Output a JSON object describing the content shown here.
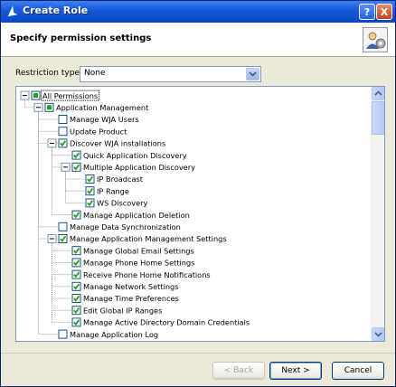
{
  "window": {
    "title": "Create Role",
    "help_label": "?",
    "close_label": "X"
  },
  "header": {
    "title": "Specify permission settings"
  },
  "restriction": {
    "label": "Restriction type",
    "value": "None"
  },
  "tree": {
    "items": [
      {
        "label": "All Permissions",
        "level": 0,
        "check": "partial",
        "expander": "minus",
        "selected": true
      },
      {
        "label": "Application Management",
        "level": 1,
        "check": "partial",
        "expander": "minus"
      },
      {
        "label": "Manage WJA Users",
        "level": 2,
        "check": "unchecked",
        "expander": "none"
      },
      {
        "label": "Update Product",
        "level": 2,
        "check": "unchecked",
        "expander": "none"
      },
      {
        "label": "Discover WJA installations",
        "level": 2,
        "check": "checked",
        "expander": "minus"
      },
      {
        "label": "Quick Application Discovery",
        "level": 3,
        "check": "checked",
        "expander": "none"
      },
      {
        "label": "Multiple Application Discovery",
        "level": 3,
        "check": "checked",
        "expander": "minus"
      },
      {
        "label": "IP Broadcast",
        "level": 4,
        "check": "checked",
        "expander": "none"
      },
      {
        "label": "IP Range",
        "level": 4,
        "check": "checked",
        "expander": "none"
      },
      {
        "label": "WS Discovery",
        "level": 4,
        "check": "checked",
        "expander": "none"
      },
      {
        "label": "Manage Application Deletion",
        "level": 3,
        "check": "checked",
        "expander": "none"
      },
      {
        "label": "Manage Data Synchronization",
        "level": 2,
        "check": "unchecked",
        "expander": "none"
      },
      {
        "label": "Manage Application Management Settings",
        "level": 2,
        "check": "checked",
        "expander": "minus"
      },
      {
        "label": "Manage Global Email Settings",
        "level": 3,
        "check": "checked",
        "expander": "none"
      },
      {
        "label": "Manage Phone Home Settings",
        "level": 3,
        "check": "checked",
        "expander": "none"
      },
      {
        "label": "Receive Phone Home Notifications",
        "level": 3,
        "check": "checked",
        "expander": "none"
      },
      {
        "label": "Manage Network Settings",
        "level": 3,
        "check": "checked",
        "expander": "none"
      },
      {
        "label": "Manage Time Preferences",
        "level": 3,
        "check": "checked",
        "expander": "none"
      },
      {
        "label": "Edit Global IP Ranges",
        "level": 3,
        "check": "checked",
        "expander": "none"
      },
      {
        "label": "Manage Active Directory Domain Credentials",
        "level": 3,
        "check": "checked",
        "expander": "none"
      },
      {
        "label": "Manage Application Log",
        "level": 2,
        "check": "unchecked",
        "expander": "none"
      }
    ]
  },
  "buttons": {
    "back": "< Back",
    "next": "Next >",
    "cancel": "Cancel"
  },
  "colors": {
    "titlebar": "#0a47c4",
    "check": "#21a121",
    "selection": "#316ac5"
  }
}
